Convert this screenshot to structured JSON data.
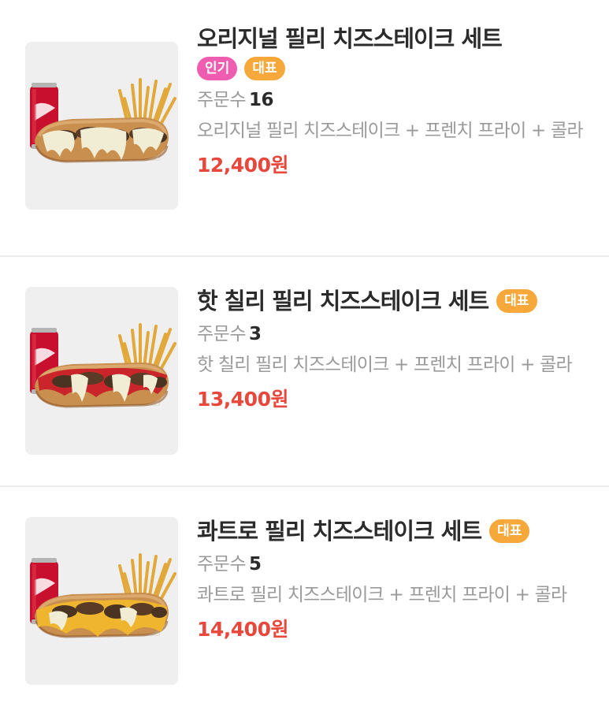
{
  "menu": {
    "items": [
      {
        "name": "오리지널 필리 치즈스테이크 세트",
        "badges": [
          "인기",
          "대표"
        ],
        "orders_label": "주문수",
        "orders_count": "16",
        "description": "오리지널 필리 치즈스테이크 + 프렌치 프라이 + 콜라",
        "price": "12,400원",
        "image_icon": "cheesesteak-set-photo-original"
      },
      {
        "name": "핫 칠리 필리 치즈스테이크 세트",
        "badges": [
          "대표"
        ],
        "orders_label": "주문수",
        "orders_count": "3",
        "description": "핫 칠리 필리 치즈스테이크 + 프렌치 프라이 + 콜라",
        "price": "13,400원",
        "image_icon": "cheesesteak-set-photo-hot-chili"
      },
      {
        "name": "콰트로 필리 치즈스테이크 세트",
        "badges": [
          "대표"
        ],
        "orders_label": "주문수",
        "orders_count": "5",
        "description": "콰트로 필리 치즈스테이크 + 프렌치 프라이 + 콜라",
        "price": "14,400원",
        "image_icon": "cheesesteak-set-photo-quattro"
      }
    ]
  },
  "colors": {
    "price": "#e8473c",
    "badge_popular": "#ee5db0",
    "badge_signature": "#f6a83b",
    "title": "#2b2b2b",
    "muted_text": "#9a9a9a",
    "divider": "#ececec",
    "thumb_bg": "#efefef"
  }
}
